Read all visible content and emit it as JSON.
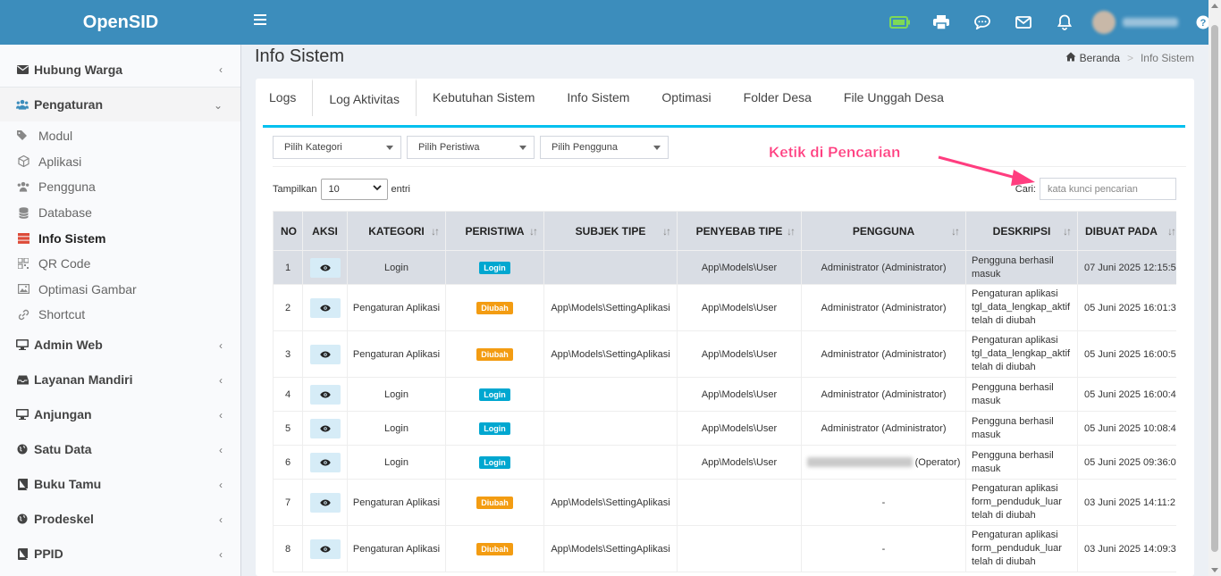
{
  "app": {
    "name": "OpenSID"
  },
  "header": {
    "menu_icon": "hamburger-icon",
    "icons": [
      "battery-icon",
      "printer-icon",
      "chat-icon",
      "mail-icon",
      "bell-icon"
    ],
    "help_icon": "help-circle-icon",
    "user_name": "Administrator"
  },
  "sidebar": {
    "items": [
      {
        "label": "Hubung Warga",
        "icon": "envelope-icon"
      },
      {
        "label": "Pengaturan",
        "icon": "users-icon"
      },
      {
        "label": "Admin Web",
        "icon": "desktop-icon"
      },
      {
        "label": "Layanan Mandiri",
        "icon": "inbox-icon"
      },
      {
        "label": "Anjungan",
        "icon": "monitor-icon"
      },
      {
        "label": "Satu Data",
        "icon": "globe-icon"
      },
      {
        "label": "Buku Tamu",
        "icon": "book-icon"
      },
      {
        "label": "Prodeskel",
        "icon": "globe-icon"
      },
      {
        "label": "PPID",
        "icon": "book-icon"
      }
    ],
    "sub_items": [
      {
        "label": "Modul",
        "icon": "tags-icon"
      },
      {
        "label": "Aplikasi",
        "icon": "cube-icon"
      },
      {
        "label": "Pengguna",
        "icon": "users-icon"
      },
      {
        "label": "Database",
        "icon": "database-icon"
      },
      {
        "label": "Info Sistem",
        "icon": "server-icon"
      },
      {
        "label": "QR Code",
        "icon": "qrcode-icon"
      },
      {
        "label": "Optimasi Gambar",
        "icon": "image-icon"
      },
      {
        "label": "Shortcut",
        "icon": "link-icon"
      }
    ]
  },
  "page": {
    "title": "Info Sistem",
    "breadcrumb": {
      "home": "Beranda",
      "current": "Info Sistem"
    }
  },
  "tabs": [
    "Logs",
    "Log Aktivitas",
    "Kebutuhan Sistem",
    "Info Sistem",
    "Optimasi",
    "Folder Desa",
    "File Unggah Desa"
  ],
  "filters": {
    "kategori": "Pilih Kategori",
    "peristiwa": "Pilih Peristiwa",
    "pengguna": "Pilih Pengguna"
  },
  "length": {
    "prefix": "Tampilkan",
    "value": "10",
    "suffix": "entri"
  },
  "search": {
    "label": "Cari:",
    "placeholder": "kata kunci pencarian"
  },
  "annotation": {
    "text": "Ketik di Pencarian",
    "color": "#ff3d7f"
  },
  "table": {
    "headers": [
      "NO",
      "AKSI",
      "KATEGORI",
      "PERISTIWA",
      "SUBJEK TIPE",
      "PENYEBAB TIPE",
      "PENGGUNA",
      "DESKRIPSI",
      "DIBUAT PADA"
    ],
    "rows": [
      {
        "no": "1",
        "kategori": "Login",
        "peristiwa": "Login",
        "subjek": "",
        "penyebab": "App\\Models\\User",
        "pengguna": "Administrator (Administrator)",
        "deskripsi": [
          "Pengguna berhasil",
          "masuk"
        ],
        "dibuat": "07 Juni 2025 12:15:5"
      },
      {
        "no": "2",
        "kategori": "Pengaturan Aplikasi",
        "peristiwa": "Diubah",
        "subjek": "App\\Models\\SettingAplikasi",
        "penyebab": "App\\Models\\User",
        "pengguna": "Administrator (Administrator)",
        "deskripsi": [
          "Pengaturan aplikasi",
          "tgl_data_lengkap_aktif",
          "telah di diubah"
        ],
        "dibuat": "05 Juni 2025 16:01:3"
      },
      {
        "no": "3",
        "kategori": "Pengaturan Aplikasi",
        "peristiwa": "Diubah",
        "subjek": "App\\Models\\SettingAplikasi",
        "penyebab": "App\\Models\\User",
        "pengguna": "Administrator (Administrator)",
        "deskripsi": [
          "Pengaturan aplikasi",
          "tgl_data_lengkap_aktif",
          "telah di diubah"
        ],
        "dibuat": "05 Juni 2025 16:00:5"
      },
      {
        "no": "4",
        "kategori": "Login",
        "peristiwa": "Login",
        "subjek": "",
        "penyebab": "App\\Models\\User",
        "pengguna": "Administrator (Administrator)",
        "deskripsi": [
          "Pengguna berhasil",
          "masuk"
        ],
        "dibuat": "05 Juni 2025 16:00:4"
      },
      {
        "no": "5",
        "kategori": "Login",
        "peristiwa": "Login",
        "subjek": "",
        "penyebab": "App\\Models\\User",
        "pengguna": "Administrator (Administrator)",
        "deskripsi": [
          "Pengguna berhasil",
          "masuk"
        ],
        "dibuat": "05 Juni 2025 10:08:4"
      },
      {
        "no": "6",
        "kategori": "Login",
        "peristiwa": "Login",
        "subjek": "",
        "penyebab": "App\\Models\\User",
        "pengguna": "(Operator)",
        "pengguna_blurred": true,
        "deskripsi": [
          "Pengguna berhasil",
          "masuk"
        ],
        "dibuat": "05 Juni 2025 09:36:0"
      },
      {
        "no": "7",
        "kategori": "Pengaturan Aplikasi",
        "peristiwa": "Diubah",
        "subjek": "App\\Models\\SettingAplikasi",
        "penyebab": "",
        "pengguna": "-",
        "deskripsi": [
          "Pengaturan aplikasi",
          "form_penduduk_luar",
          "telah di diubah"
        ],
        "dibuat": "03 Juni 2025 14:11:2"
      },
      {
        "no": "8",
        "kategori": "Pengaturan Aplikasi",
        "peristiwa": "Diubah",
        "subjek": "App\\Models\\SettingAplikasi",
        "penyebab": "",
        "pengguna": "-",
        "deskripsi": [
          "Pengaturan aplikasi",
          "form_penduduk_luar",
          "telah di diubah"
        ],
        "dibuat": "03 Juni 2025 14:09:3"
      }
    ]
  },
  "colors": {
    "header": "#3c8dbc",
    "tab_accent": "#00c0ef",
    "badge_login": "#00a7d0",
    "badge_diubah": "#f39c12"
  }
}
